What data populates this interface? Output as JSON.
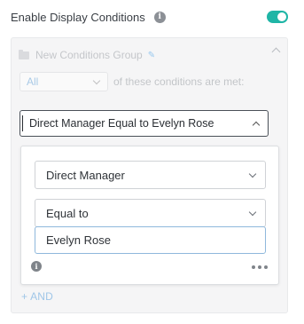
{
  "header": {
    "label": "Enable Display Conditions",
    "info_icon": "i",
    "toggle_on": true,
    "toggle_color": "#1fb5a6"
  },
  "group": {
    "title": "New Conditions Group",
    "match_select": {
      "selected": "All"
    },
    "match_text": "of these conditions are met:",
    "condition_summary": "Direct Manager Equal to Evelyn Rose",
    "editor": {
      "field_select": {
        "selected": "Direct Manager"
      },
      "operator_select": {
        "selected": "Equal to"
      },
      "value_input": {
        "value": "Evelyn Rose"
      },
      "info_icon": "i"
    },
    "add_and_label": "+ AND"
  },
  "icons": {
    "info": "info-icon",
    "toggle": "toggle-switch",
    "folder": "folder-icon",
    "pencil": "pencil-icon",
    "chevron_up": "chevron-up-icon",
    "chevron_down": "chevron-down-icon",
    "more": "more-horizontal-icon"
  },
  "colors": {
    "accent": "#1fb5a6",
    "link": "#4aa3e8",
    "focus_border": "#8fb8dc"
  }
}
